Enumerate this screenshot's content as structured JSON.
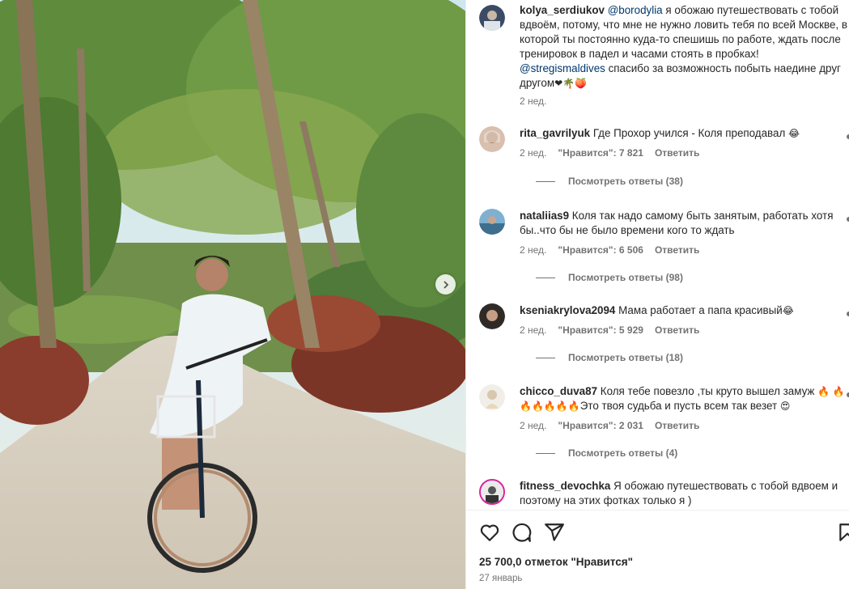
{
  "post": {
    "caption_user": "kolya_serdiukov",
    "caption_mention": "@borodylia",
    "caption_text": "я обожаю путешествовать с тобой вдвоём, потому, что мне не нужно ловить тебя по всей Москве, в которой ты постоянно куда-то спешишь по работе, ждать после тренировок в падел и часами стоять в пробках!",
    "caption_mention2": "@stregismaldives",
    "caption_text2": "спасибо за возможность побыть наедине друг другом",
    "caption_emojis": "❤🌴🍑",
    "caption_time": "2 нед."
  },
  "comments": [
    {
      "user": "rita_gavrilyuk",
      "text": "Где Прохор учился - Коля преподавал",
      "emoji": "😂",
      "time": "2 нед.",
      "likes": "\"Нравится\": 7 821",
      "reply": "Ответить",
      "replies": "Посмотреть ответы (38)"
    },
    {
      "user": "nataliias9",
      "text": "Коля так надо самому быть занятым, работать хотя бы..что бы не было времени кого то ждать",
      "emoji": "",
      "time": "2 нед.",
      "likes": "\"Нравится\": 6 506",
      "reply": "Ответить",
      "replies": "Посмотреть ответы (98)"
    },
    {
      "user": "kseniakrylova2094",
      "text": "Мама работает а папа красивый",
      "emoji": "😂",
      "time": "2 нед.",
      "likes": "\"Нравится\": 5 929",
      "reply": "Ответить",
      "replies": "Посмотреть ответы (18)"
    },
    {
      "user": "chicco_duva87",
      "text": "Коля тебе повезло ,ты круто вышел замуж",
      "emoji": "🔥",
      "emoji_row": "🔥🔥🔥🔥🔥🔥",
      "text2": "Это твоя судьба и пусть всем так везет",
      "emoji2": "😍",
      "time": "2 нед.",
      "likes": "\"Нравится\": 2 031",
      "reply": "Ответить",
      "replies": "Посмотреть ответы (4)"
    },
    {
      "user": "fitness_devochka",
      "text": "Я обожаю путешествовать с тобой вдвоем и поэтому на этих фотках только я )"
    }
  ],
  "footer": {
    "likes": "25 700,0 отметок \"Нравится\"",
    "date": "27 январь"
  },
  "icons": {
    "like": "heart-icon",
    "comment": "comment-icon",
    "share": "share-icon",
    "save": "bookmark-icon",
    "next": "chevron-right-icon"
  },
  "colors": {
    "mention": "#00376b",
    "muted": "#737373",
    "text": "#262626"
  }
}
